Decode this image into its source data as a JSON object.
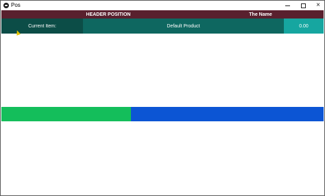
{
  "window": {
    "title": "Pos",
    "controls": {
      "minimize": "minimize-icon",
      "maximize": "maximize-icon",
      "close": "×"
    }
  },
  "header": {
    "position_label": "HEADER POSITION",
    "name_label": "The Name"
  },
  "item_row": {
    "current_label": "Current Item:",
    "product_name": "Default Product",
    "price": "0.00"
  },
  "colors": {
    "header_bg": "#59202e",
    "current_label_bg": "#0c4d47",
    "product_bg": "#0e6760",
    "price_bg": "#16a6a0",
    "green_bar": "#14be5b",
    "blue_bar": "#0c55d4"
  }
}
